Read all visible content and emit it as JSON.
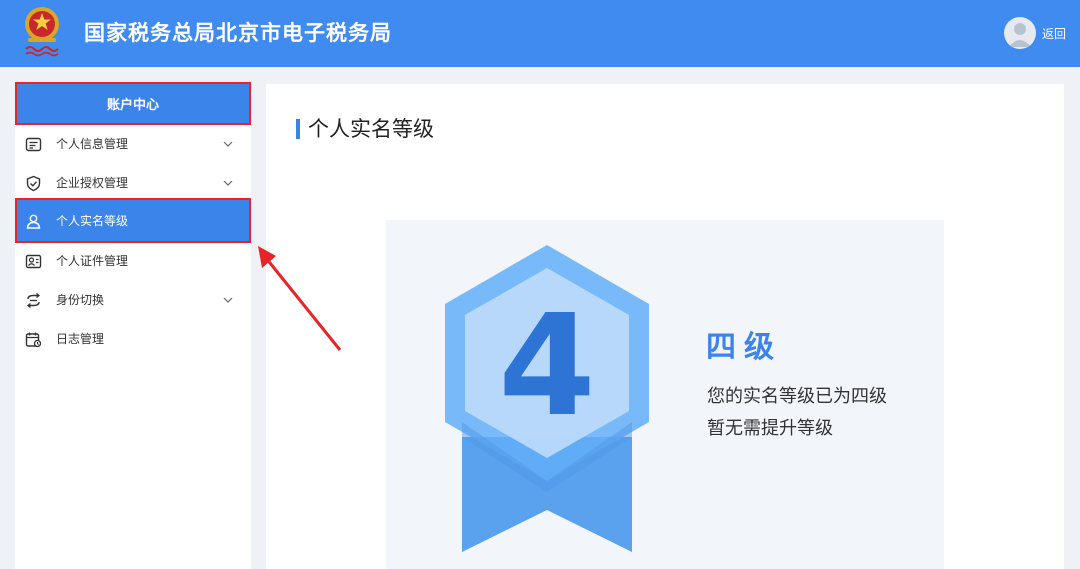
{
  "header": {
    "title": "国家税务总局北京市电子税务局",
    "back_label": "返回",
    "emblem_icon": "tax-emblem-icon",
    "avatar_icon": "user-avatar-icon",
    "background_color": "#3f8bf0"
  },
  "sidebar": {
    "section_title": "账户中心",
    "items": [
      {
        "label": "个人信息管理",
        "icon": "id-card-icon",
        "has_submenu": true,
        "active": false
      },
      {
        "label": "企业授权管理",
        "icon": "shield-check-icon",
        "has_submenu": true,
        "active": false
      },
      {
        "label": "个人实名等级",
        "icon": "user-level-icon",
        "has_submenu": false,
        "active": true
      },
      {
        "label": "个人证件管理",
        "icon": "certificate-icon",
        "has_submenu": false,
        "active": false
      },
      {
        "label": "身份切换",
        "icon": "switch-icon",
        "has_submenu": true,
        "active": false
      },
      {
        "label": "日志管理",
        "icon": "log-calendar-icon",
        "has_submenu": false,
        "active": false
      }
    ],
    "active_color": "#3b84ea",
    "highlight_border_color": "#e8242b"
  },
  "main": {
    "title": "个人实名等级",
    "level": {
      "badge_number": "4",
      "name": "四级",
      "description_line1": "您的实名等级已为四级",
      "description_line2": "暂无需提升等级",
      "accent_color": "#3b84ea"
    }
  },
  "annotation": {
    "arrow_icon": "red-arrow-icon",
    "color": "#e8242b"
  }
}
